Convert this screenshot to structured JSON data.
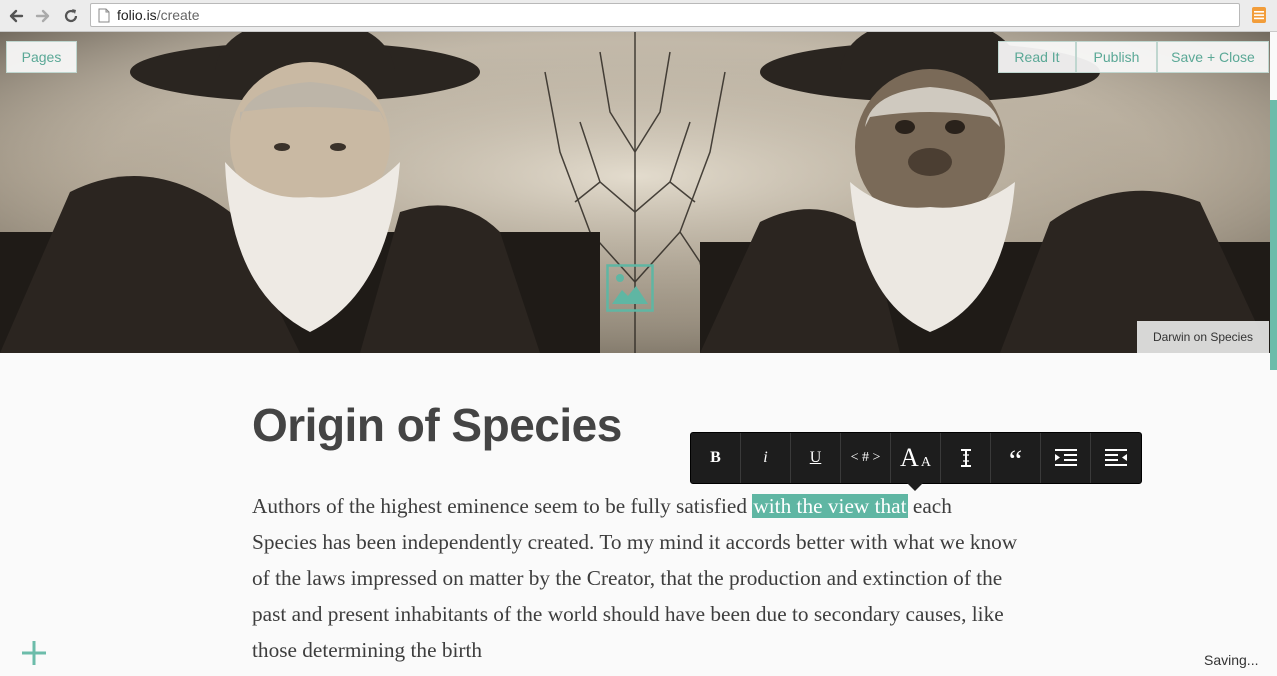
{
  "browser": {
    "url_domain": "folio.is",
    "url_path": "/create"
  },
  "hero": {
    "pages_label": "Pages",
    "read_label": "Read It",
    "publish_label": "Publish",
    "save_close_label": "Save + Close",
    "caption": "Darwin on Species",
    "accent_color": "#5fb6a3"
  },
  "article": {
    "title": "Origin of Species",
    "paragraph_before": "Authors of the highest eminence seem to be fully satisfied ",
    "highlighted": "with the view that",
    "paragraph_after": " each Species has been independently created. To my mind it accords better with what we know of the laws impressed on matter by the Creator, that the production and extinction of the past and present inhabitants of the world should have been due to secondary causes, like those determining the birth"
  },
  "toolbar": {
    "bold": "B",
    "italic": "i",
    "underline": "U",
    "code": "< # >",
    "font_size_big": "A",
    "font_size_small": "A",
    "quote": "“",
    "icons": [
      "bold-icon",
      "italic-icon",
      "underline-icon",
      "code-icon",
      "font-size-icon",
      "text-height-icon",
      "quote-icon",
      "indent-icon",
      "outdent-icon"
    ]
  },
  "status": "Saving..."
}
